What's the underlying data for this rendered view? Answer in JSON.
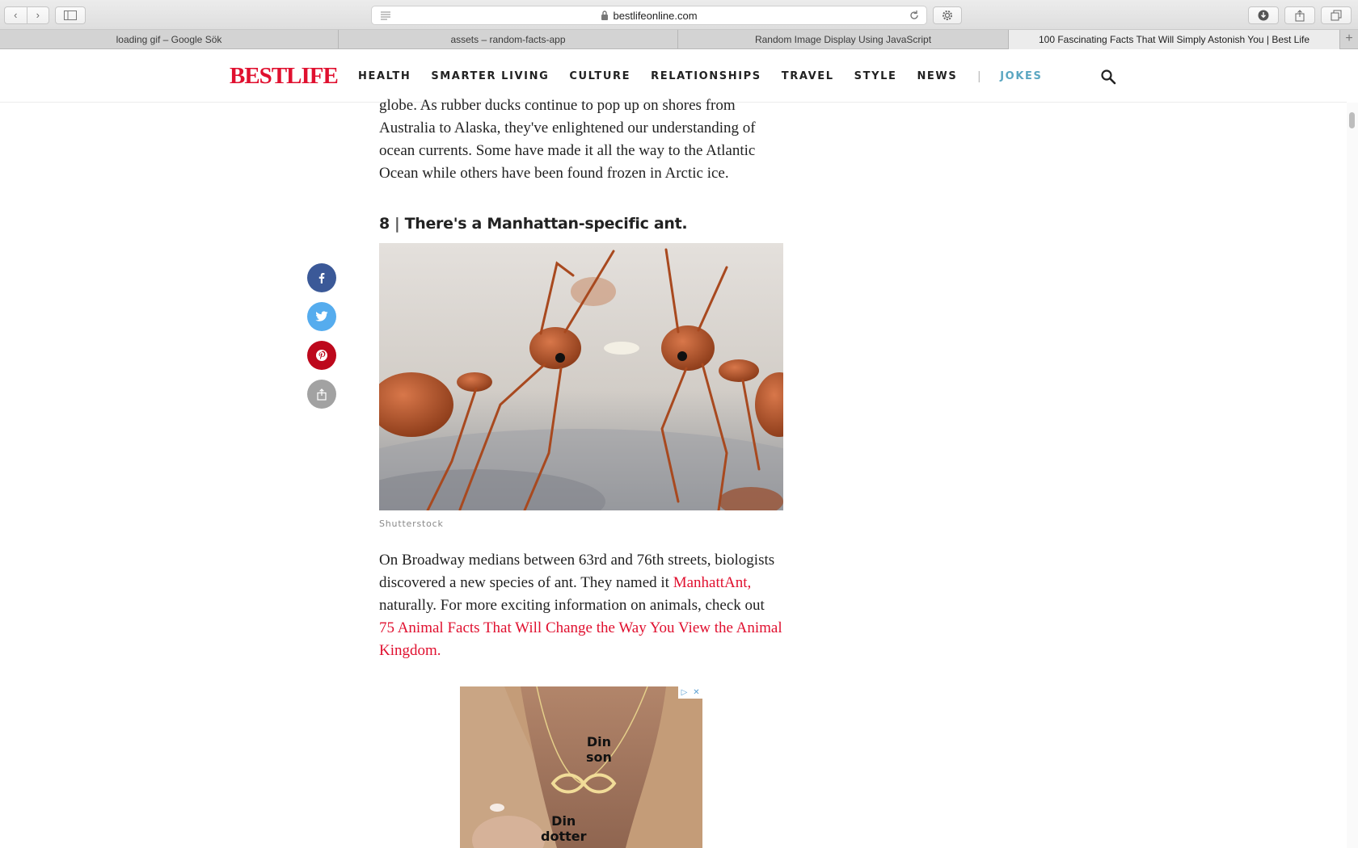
{
  "browser": {
    "url": "bestlifeonline.com",
    "tabs": [
      {
        "title": "loading gif – Google Sök"
      },
      {
        "title": "assets – random-facts-app"
      },
      {
        "title": "Random Image Display Using JavaScript"
      },
      {
        "title": "100 Fascinating Facts That Will Simply Astonish You | Best Life",
        "active": true
      }
    ],
    "new_tab_label": "+"
  },
  "site": {
    "logo": "BESTLIFE",
    "brand_color": "#e0102f",
    "nav": [
      "HEALTH",
      "SMARTER LIVING",
      "CULTURE",
      "RELATIONSHIPS",
      "TRAVEL",
      "STYLE",
      "NEWS"
    ],
    "nav_separator": "|",
    "nav_accent": "JOKES",
    "nav_accent_color": "#5aa6c1"
  },
  "article": {
    "intro_para": "globe. As rubber ducks continue to pop up on shores from Australia to Alaska, they've enlightened our understanding of ocean currents. Some have made it all the way to the Atlantic Ocean while others have been found frozen in Arctic ice.",
    "fact_number": "8",
    "fact_separator": "|",
    "fact_title": "There's a Manhattan-specific ant.",
    "image_caption": "Shutterstock",
    "body_part1": "On Broadway medians between 63rd and 76th streets, biologists discovered a new species of ant. They named it ",
    "link_ant": "ManhattAnt,",
    "body_part2": " naturally. For more exciting information on animals, check out ",
    "link_facts": "75 Animal Facts That Will Change the Way You View the Animal Kingdom",
    "body_end": "."
  },
  "share": [
    "facebook-icon",
    "twitter-icon",
    "pinterest-icon",
    "share-icon"
  ],
  "ad": {
    "badge_info": "▷",
    "badge_close": "✕",
    "text_top": "Din son",
    "text_top_line1": "Din",
    "text_top_line2": "son",
    "text_bottom_line1": "Din",
    "text_bottom_line2": "dotter"
  }
}
